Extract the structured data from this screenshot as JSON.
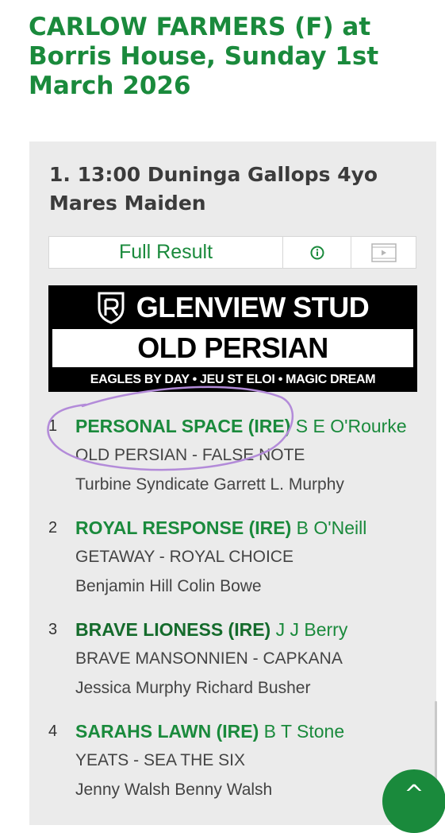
{
  "page": {
    "title": "CARLOW FARMERS (F) at Borris House, Sunday 1st March 2026"
  },
  "race": {
    "title": "1. 13:00 Duninga Gallops 4yo Mares Maiden",
    "full_result_label": "Full Result",
    "info_icon": "info-icon",
    "video_icon": "video-icon"
  },
  "advert": {
    "brand": "GLENVIEW STUD",
    "stallion": "OLD PERSIAN",
    "tagline": "EAGLES BY DAY • JEU ST ELOI • MAGIC DREAM"
  },
  "runners": [
    {
      "position": "1",
      "horse": "PERSONAL SPACE (IRE)",
      "jockey": "S E O'Rourke",
      "breeding": "OLD PERSIAN - FALSE NOTE",
      "connections": "Turbine Syndicate Garrett L. Murphy"
    },
    {
      "position": "2",
      "horse": "ROYAL RESPONSE (IRE)",
      "jockey": "B O'Neill",
      "breeding": "GETAWAY - ROYAL CHOICE",
      "connections": "Benjamin Hill Colin Bowe"
    },
    {
      "position": "3",
      "horse": "BRAVE LIONESS (IRE)",
      "jockey": "J J Berry",
      "breeding": "BRAVE MANSONNIEN - CAPKANA",
      "connections": "Jessica Murphy Richard Busher"
    },
    {
      "position": "4",
      "horse": "SARAHS LAWN (IRE)",
      "jockey": "B T Stone",
      "breeding": "YEATS - SEA THE SIX",
      "connections": "Jenny Walsh Benny Walsh"
    }
  ],
  "back_to_top_label": "^",
  "colors": {
    "accent_green": "#1a8a3c",
    "annotation_purple": "#b38bd9",
    "card_bg": "#ebebeb"
  }
}
